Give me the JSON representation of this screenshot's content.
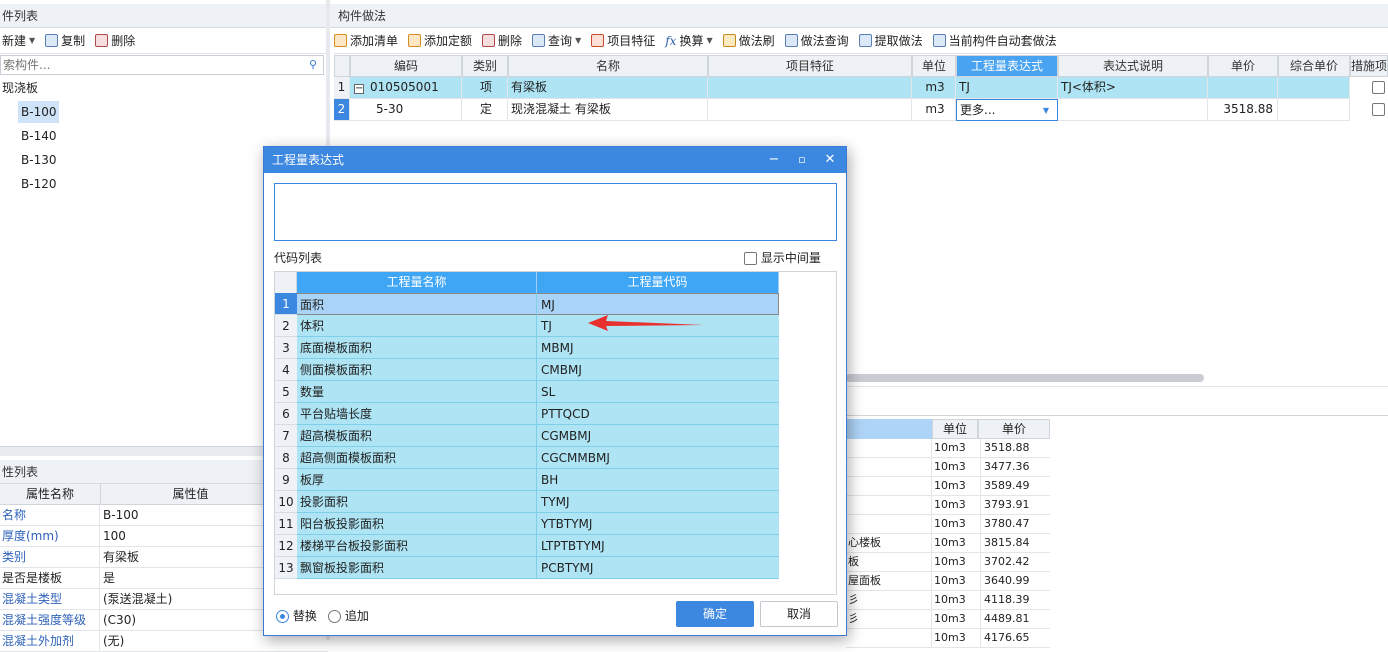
{
  "left_panel": {
    "title": "件列表",
    "toolbar": {
      "new": "新建",
      "copy": "复制",
      "delete": "删除"
    },
    "search_placeholder": "索构件...",
    "tree_root": "现浇板",
    "tree_items": [
      "B-100",
      "B-140",
      "B-130",
      "B-120"
    ]
  },
  "props_panel": {
    "title": "性列表",
    "col_name": "属性名称",
    "col_value": "属性值",
    "rows": [
      {
        "name": "名称",
        "value": "B-100"
      },
      {
        "name": "厚度(mm)",
        "value": "100"
      },
      {
        "name": "类别",
        "value": "有梁板"
      },
      {
        "name": "是否是楼板",
        "value": "是"
      },
      {
        "name": "混凝土类型",
        "value": "(泵送混凝土)"
      },
      {
        "name": "混凝土强度等级",
        "value": "(C30)"
      },
      {
        "name": "混凝土外加剂",
        "value": "(无)"
      }
    ]
  },
  "right_panel": {
    "title": "构件做法",
    "toolbar": [
      "添加清单",
      "添加定额",
      "删除",
      "查询",
      "项目特征",
      "换算",
      "做法刷",
      "做法查询",
      "提取做法",
      "当前构件自动套做法"
    ],
    "columns": [
      "编码",
      "类别",
      "名称",
      "项目特征",
      "单位",
      "工程量表达式",
      "表达式说明",
      "单价",
      "综合单价",
      "措施项"
    ],
    "rows": [
      {
        "num": "1",
        "code": "010505001",
        "type": "项",
        "name": "有梁板",
        "feature": "",
        "unit": "m3",
        "expr": "TJ",
        "desc": "TJ<体积>",
        "price": "",
        "comp": ""
      },
      {
        "num": "2",
        "code": "5-30",
        "type": "定",
        "name": "现浇混凝土 有梁板",
        "feature": "",
        "unit": "m3",
        "expr": "更多...",
        "desc": "",
        "price": "3518.88",
        "comp": ""
      }
    ]
  },
  "bottom_table": {
    "col_unit": "单位",
    "col_price": "单价",
    "rows": [
      {
        "name": "",
        "unit": "10m3",
        "price": "3518.88"
      },
      {
        "name": "",
        "unit": "10m3",
        "price": "3477.36"
      },
      {
        "name": "",
        "unit": "10m3",
        "price": "3589.49"
      },
      {
        "name": "",
        "unit": "10m3",
        "price": "3793.91"
      },
      {
        "name": "",
        "unit": "10m3",
        "price": "3780.47"
      },
      {
        "name": "心楼板",
        "unit": "10m3",
        "price": "3815.84"
      },
      {
        "name": "板",
        "unit": "10m3",
        "price": "3702.42"
      },
      {
        "name": "屋面板",
        "unit": "10m3",
        "price": "3640.99"
      },
      {
        "name": "彡",
        "unit": "10m3",
        "price": "4118.39"
      },
      {
        "name": "彡",
        "unit": "10m3",
        "price": "4489.81"
      },
      {
        "name": "",
        "unit": "10m3",
        "price": "4176.65"
      }
    ]
  },
  "dialog": {
    "title": "工程量表达式",
    "code_list_label": "代码列表",
    "show_intermediate": "显示中间量",
    "col_name": "工程量名称",
    "col_code": "工程量代码",
    "rows": [
      {
        "num": "1",
        "name": "面积",
        "code": "MJ"
      },
      {
        "num": "2",
        "name": "体积",
        "code": "TJ"
      },
      {
        "num": "3",
        "name": "底面模板面积",
        "code": "MBMJ"
      },
      {
        "num": "4",
        "name": "侧面模板面积",
        "code": "CMBMJ"
      },
      {
        "num": "5",
        "name": "数量",
        "code": "SL"
      },
      {
        "num": "6",
        "name": "平台贴墙长度",
        "code": "PTTQCD"
      },
      {
        "num": "7",
        "name": "超高模板面积",
        "code": "CGMBMJ"
      },
      {
        "num": "8",
        "name": "超高侧面模板面积",
        "code": "CGCMMBMJ"
      },
      {
        "num": "9",
        "name": "板厚",
        "code": "BH"
      },
      {
        "num": "10",
        "name": "投影面积",
        "code": "TYMJ"
      },
      {
        "num": "11",
        "name": "阳台板投影面积",
        "code": "YTBTYMJ"
      },
      {
        "num": "12",
        "name": "楼梯平台板投影面积",
        "code": "LTPTBTYMJ"
      },
      {
        "num": "13",
        "name": "飘窗板投影面积",
        "code": "PCBTYMJ"
      }
    ],
    "replace_label": "替换",
    "append_label": "追加",
    "ok_label": "确定",
    "cancel_label": "取消",
    "accent": "#3c87e0",
    "arrow_color": "#e8312f"
  }
}
